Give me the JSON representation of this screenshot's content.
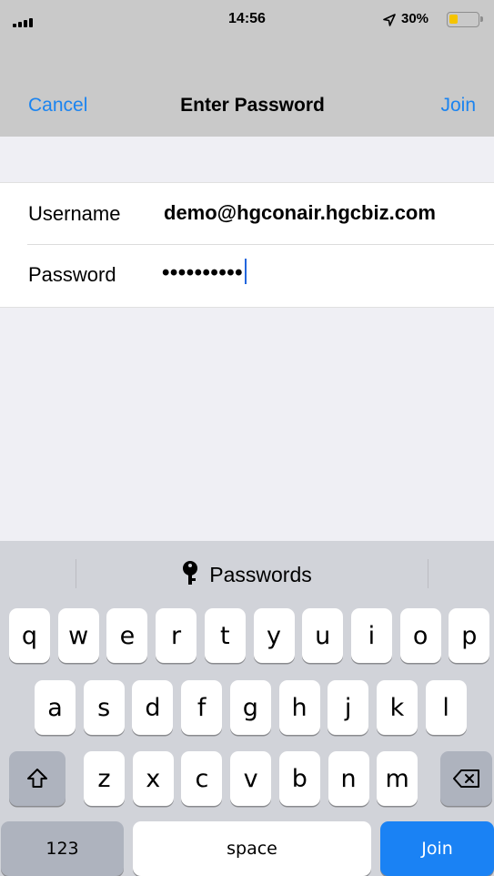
{
  "status_bar": {
    "time": "14:56",
    "battery_percent": "30%",
    "battery_level": 0.3,
    "battery_color": "#f5c400",
    "signal_icon": "signal-bars-icon",
    "location_icon": "location-arrow-icon"
  },
  "nav": {
    "cancel_label": "Cancel",
    "title": "Enter Password",
    "join_label": "Join",
    "accent_color": "#1b84f0"
  },
  "form": {
    "username_label": "Username",
    "username_value": "demo@hgconair.hgcbiz.com",
    "password_label": "Password",
    "password_value": "••••••••••"
  },
  "keyboard": {
    "suggestion": {
      "icon": "key-icon",
      "label": "Passwords"
    },
    "row1": [
      "q",
      "w",
      "e",
      "r",
      "t",
      "y",
      "u",
      "i",
      "o",
      "p"
    ],
    "row2": [
      "a",
      "s",
      "d",
      "f",
      "g",
      "h",
      "j",
      "k",
      "l"
    ],
    "row3": [
      "z",
      "x",
      "c",
      "v",
      "b",
      "n",
      "m"
    ],
    "shift_icon": "shift-icon",
    "delete_icon": "backspace-icon",
    "numbers_label": "123",
    "space_label": "space",
    "join_label": "Join",
    "join_color": "#1a82f4"
  }
}
